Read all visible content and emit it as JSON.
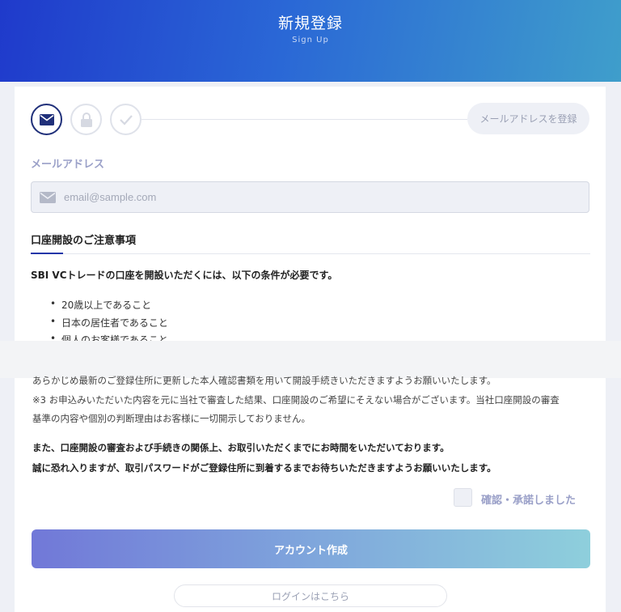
{
  "header": {
    "title": "新規登録",
    "subtitle": "Sign Up"
  },
  "steps": [
    {
      "icon": "envelope-icon",
      "state": "active"
    },
    {
      "icon": "lock-icon",
      "state": "pending"
    },
    {
      "icon": "check-icon",
      "state": "pending"
    }
  ],
  "step_label": "メールアドレスを登録",
  "email": {
    "label": "メールアドレス",
    "value": "",
    "placeholder": "email@sample.com"
  },
  "notice": {
    "title": "口座開設のご注意事項",
    "lead": "SBI VCトレードの口座を開設いただくには、以下の条件が必要です。",
    "conditions": [
      "20歳以上であること",
      "日本の居住者であること",
      "個人のお客様であること"
    ],
    "para1": "あらかじめ最新のご登録住所に更新した本人確認書類を用いて開設手続きいただきますようお願いいたします。",
    "note3_line1": "※3 お申込みいただいた内容を元に当社で審査した結果、口座開設のご希望にそえない場合がございます。当社口座開設の審査",
    "note3_line2": "基準の内容や個別の判断理由はお客様に一切開示しておりません。",
    "bold1": "また、口座開設の審査および手続きの関係上、お取引いただくまでにお時間をいただいております。",
    "bold2": "誠に恐れ入りますが、取引パスワードがご登録住所に到着するまでお待ちいただきますようお願いいたします。"
  },
  "agree": {
    "label": "確認・承諾しました",
    "checked": false
  },
  "buttons": {
    "create": "アカウント作成",
    "login": "ログインはこちら"
  },
  "colors": {
    "accent": "#20307a",
    "gradient_start": "#7178d8",
    "gradient_end": "#8ecfdc"
  }
}
